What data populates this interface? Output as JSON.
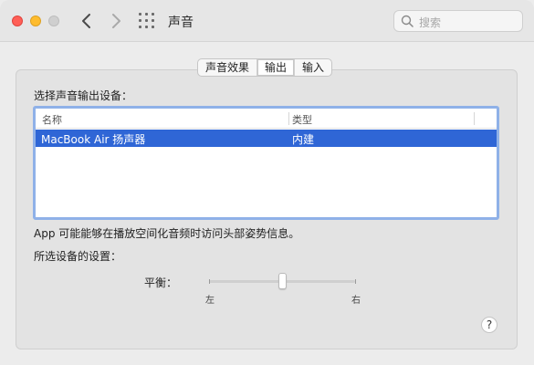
{
  "window": {
    "title": "声音"
  },
  "search": {
    "placeholder": "搜索"
  },
  "tabs": [
    {
      "label": "声音效果"
    },
    {
      "label": "输出",
      "selected": true
    },
    {
      "label": "输入"
    }
  ],
  "output": {
    "select_label": "选择声音输出设备：",
    "columns": {
      "name": "名称",
      "type": "类型"
    },
    "rows": [
      {
        "name": "MacBook Air 扬声器",
        "type": "内建",
        "selected": true
      }
    ],
    "spatial_note": "App 可能能够在播放空间化音频时访问头部姿势信息。",
    "settings_label": "所选设备的设置：",
    "balance": {
      "label": "平衡：",
      "left_label": "左",
      "right_label": "右",
      "value": 0.5
    }
  },
  "help_label": "?",
  "icons": {
    "back": "chevron-left-icon",
    "forward": "chevron-right-icon",
    "grid": "grid-icon",
    "search": "search-icon"
  },
  "colors": {
    "selection": "#2f66d6",
    "focus_ring": "#8fb1e8",
    "close": "#ff5f57",
    "minimize": "#febc2e",
    "zoom": "#cfcfcf"
  }
}
